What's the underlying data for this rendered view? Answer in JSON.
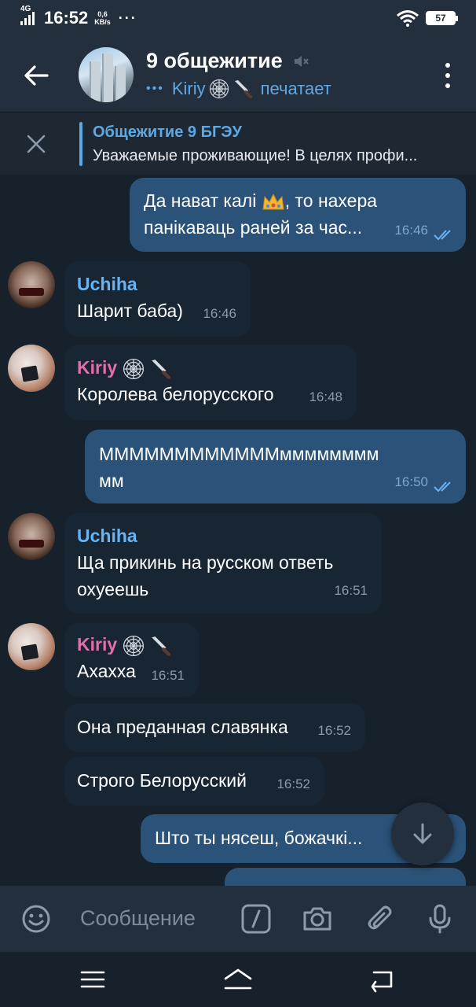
{
  "status_bar": {
    "network": "4G",
    "time": "16:52",
    "speed_value": "0,6",
    "speed_unit": "KB/s",
    "more": "···",
    "battery": "57"
  },
  "header": {
    "chat_title": "9 общежитие",
    "typing_user": "Kiriy",
    "typing_text": "печатает"
  },
  "pinned": {
    "title": "Общежитие 9 БГЭУ",
    "text": "Уважаемые проживающие! В целях профи..."
  },
  "messages": [
    {
      "dir": "out",
      "text_line1": "Да нават калі",
      "text_line1b": ", то нахера",
      "text_line2": "панікаваць раней за час...",
      "time": "16:46"
    },
    {
      "dir": "in",
      "sender": "Uchiha",
      "text": "Шарит баба)",
      "time": "16:46"
    },
    {
      "dir": "in",
      "sender": "Kiriy",
      "text": "Королева белорусского",
      "time": "16:48"
    },
    {
      "dir": "out",
      "text_line1": "ММММММММММММмммммммм",
      "text_line2": "мм",
      "time": "16:50"
    },
    {
      "dir": "in",
      "sender": "Uchiha",
      "text_line1": "Ща прикинь на русском ответь",
      "text_line2": "охуеешь",
      "time": "16:51"
    },
    {
      "dir": "in",
      "sender": "Kiriy",
      "text": "Ахахха",
      "time": "16:51"
    },
    {
      "dir": "in",
      "text": "Она преданная славянка",
      "time": "16:52"
    },
    {
      "dir": "in",
      "text": "Строго Белорусский",
      "time": "16:52"
    },
    {
      "dir": "out",
      "text": "Што ты нясеш, божачкі..."
    }
  ],
  "input": {
    "placeholder": "Сообщение"
  },
  "colors": {
    "background": "#17212b",
    "header": "#242f3d",
    "outgoing_bubble": "#2b5278",
    "incoming_bubble": "#182533",
    "accent": "#5ea8e4"
  }
}
